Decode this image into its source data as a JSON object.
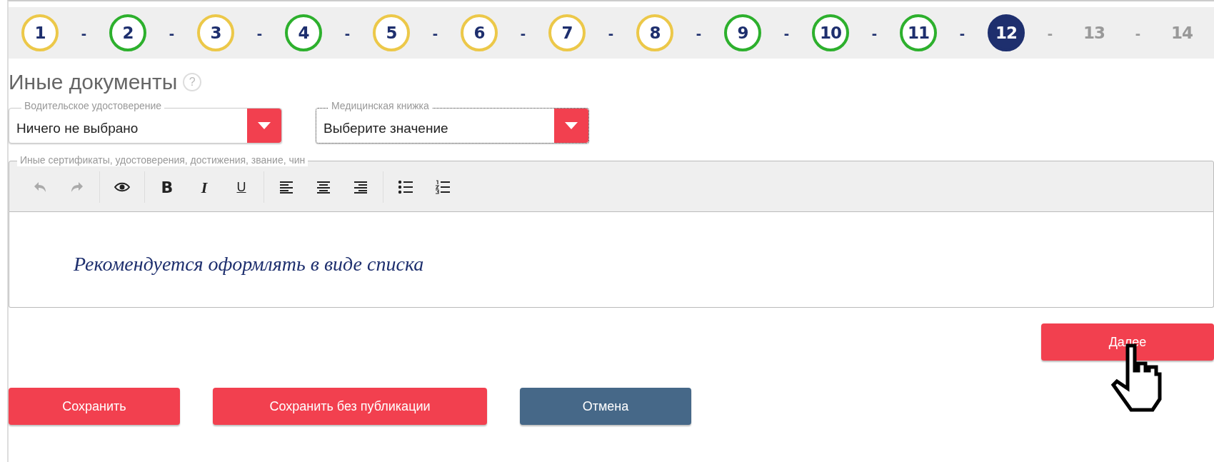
{
  "steps": {
    "separator": "-",
    "items": [
      {
        "label": "1",
        "color": "#ecc849",
        "selected": false,
        "disabled": false
      },
      {
        "label": "2",
        "color": "#2db02d",
        "selected": false,
        "disabled": false
      },
      {
        "label": "3",
        "color": "#ecc849",
        "selected": false,
        "disabled": false
      },
      {
        "label": "4",
        "color": "#2db02d",
        "selected": false,
        "disabled": false
      },
      {
        "label": "5",
        "color": "#ecc849",
        "selected": false,
        "disabled": false
      },
      {
        "label": "6",
        "color": "#ecc849",
        "selected": false,
        "disabled": false
      },
      {
        "label": "7",
        "color": "#ecc849",
        "selected": false,
        "disabled": false
      },
      {
        "label": "8",
        "color": "#ecc849",
        "selected": false,
        "disabled": false
      },
      {
        "label": "9",
        "color": "#2db02d",
        "selected": false,
        "disabled": false
      },
      {
        "label": "10",
        "color": "#2db02d",
        "selected": false,
        "disabled": false
      },
      {
        "label": "11",
        "color": "#2db02d",
        "selected": false,
        "disabled": false
      },
      {
        "label": "12",
        "color": "#1e2f6e",
        "selected": true,
        "disabled": false
      },
      {
        "label": "13",
        "selected": false,
        "disabled": true
      },
      {
        "label": "14",
        "selected": false,
        "disabled": true
      }
    ]
  },
  "section": {
    "title": "Иные документы",
    "help": "?"
  },
  "selects": [
    {
      "legend": "Водительское удостоверение",
      "value": "Ничего не выбрано",
      "focused": false
    },
    {
      "legend": "Медицинская книжка",
      "value": "Выберите значение",
      "focused": true
    }
  ],
  "editor": {
    "legend": "Иные сертификаты, удостоверения, достижения, звание, чин",
    "toolbar": [
      [
        {
          "kind": "undo",
          "disabled": true
        },
        {
          "kind": "redo",
          "disabled": true
        }
      ],
      [
        {
          "kind": "preview",
          "disabled": false
        }
      ],
      [
        {
          "kind": "bold",
          "label": "B",
          "disabled": false
        },
        {
          "kind": "italic",
          "label": "I",
          "disabled": false
        },
        {
          "kind": "underline",
          "label": "U",
          "disabled": false
        }
      ],
      [
        {
          "kind": "align-left",
          "disabled": false
        },
        {
          "kind": "align-center",
          "disabled": false
        },
        {
          "kind": "align-right",
          "disabled": false
        }
      ],
      [
        {
          "kind": "bullet-list",
          "disabled": false
        },
        {
          "kind": "numbered-list",
          "disabled": false
        }
      ]
    ],
    "placeholder": "Рекомендуется оформлять в виде списка"
  },
  "next_button": {
    "label": "Далее",
    "hovered": true
  },
  "buttons": [
    {
      "label": "Сохранить",
      "kind": "primary"
    },
    {
      "label": "Сохранить без публикации",
      "kind": "primary"
    },
    {
      "label": "Отмена",
      "kind": "secondary"
    }
  ]
}
